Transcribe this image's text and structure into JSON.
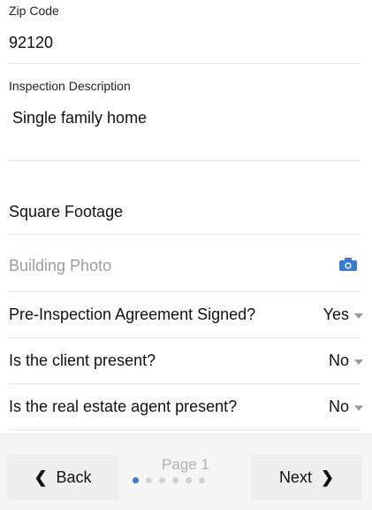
{
  "form": {
    "zip": {
      "label": "Zip Code",
      "value": "92120"
    },
    "description": {
      "label": "Inspection Description",
      "value": "Single family home"
    },
    "square_footage": {
      "placeholder": "Square Footage"
    },
    "building_photo": {
      "placeholder": "Building Photo",
      "icon": "camera-icon"
    },
    "questions": [
      {
        "label": "Pre-Inspection Agreement Signed?",
        "value": "Yes"
      },
      {
        "label": "Is the client present?",
        "value": "No"
      },
      {
        "label": "Is the real estate agent present?",
        "value": "No"
      }
    ]
  },
  "footer": {
    "back_label": "Back",
    "next_label": "Next",
    "page_label": "Page 1",
    "page_count": 6,
    "current_page": 1,
    "accent_color": "#3a7bd5"
  }
}
